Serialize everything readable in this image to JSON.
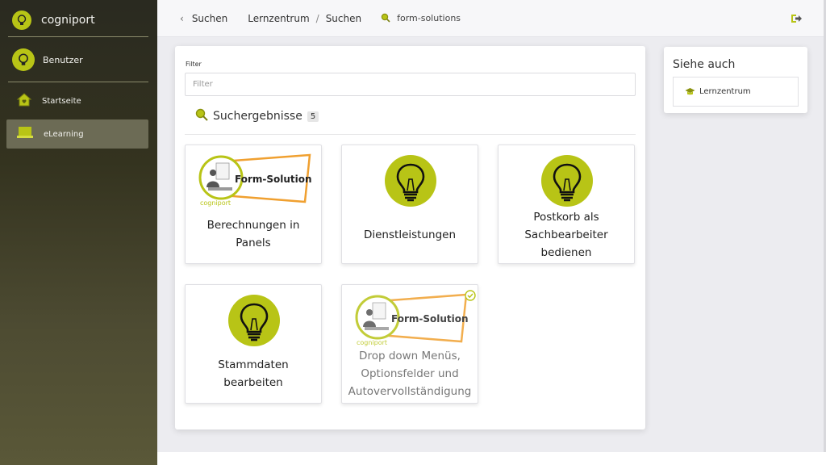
{
  "sidebar": {
    "brand": "cogniport",
    "user": "Benutzer",
    "items": [
      {
        "label": "Startseite",
        "icon": "home-icon"
      },
      {
        "label": "eLearning",
        "icon": "laptop-icon",
        "active": true
      }
    ]
  },
  "topbar": {
    "back_label": "Suchen",
    "breadcrumb": [
      "Lernzentrum",
      "Suchen"
    ],
    "breadcrumb_sep": "/",
    "search_tag": "form-solutions"
  },
  "filter": {
    "label": "Filter",
    "placeholder": "Filter",
    "value": ""
  },
  "results": {
    "title": "Suchergebnisse",
    "count": "5",
    "cards": [
      {
        "title": "Berechnungen in Panels",
        "image": "form-solutions-banner"
      },
      {
        "title": "Dienstleistungen",
        "image": "bulb-icon"
      },
      {
        "title": "Postkorb als Sachbearbeiter bedienen",
        "image": "bulb-icon"
      },
      {
        "title": "Stammdaten bearbeiten",
        "image": "bulb-icon"
      },
      {
        "title": "Drop down Menüs, Optionsfelder und Autovervollständigung",
        "image": "form-solutions-banner",
        "completed": true
      }
    ]
  },
  "banner": {
    "text": "Form-Solutions",
    "brand": "cogniport"
  },
  "see_also": {
    "title": "Siehe auch",
    "link": "Lernzentrum"
  },
  "colors": {
    "accent": "#b8c416",
    "sidebar": "#34331f",
    "orange": "#f0a030"
  }
}
